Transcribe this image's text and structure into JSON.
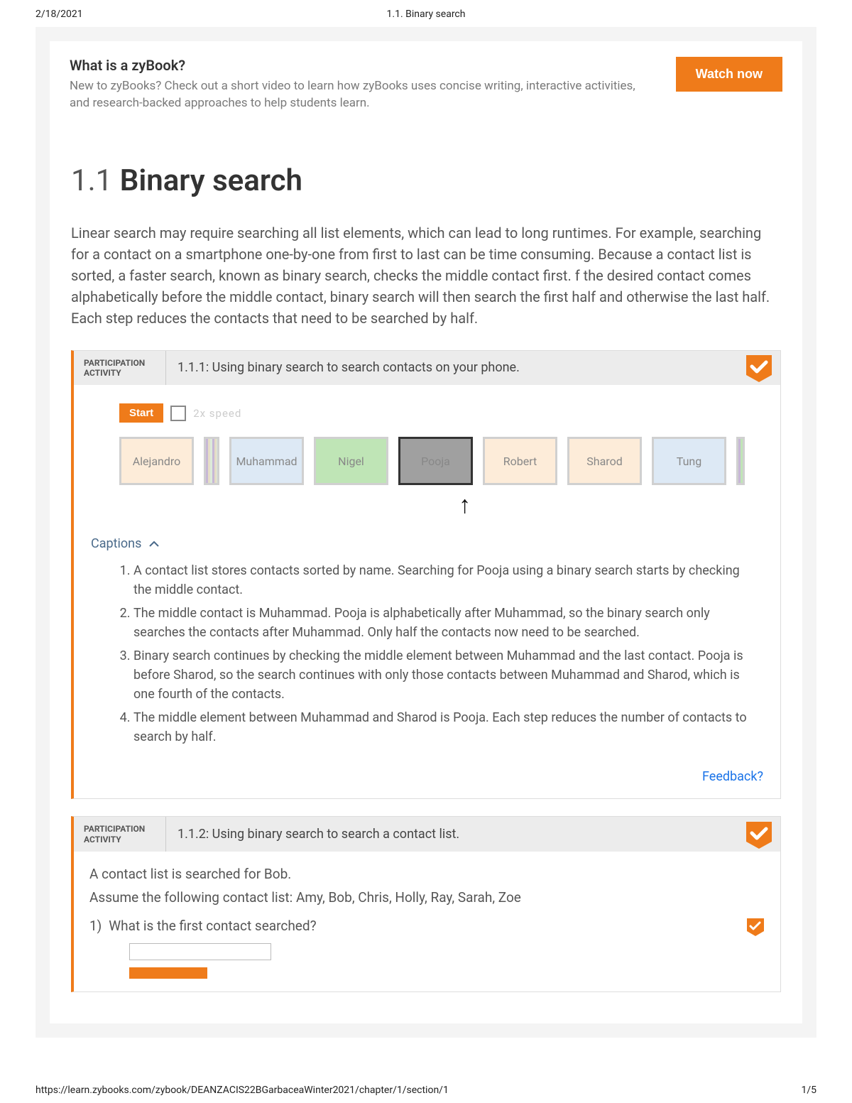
{
  "print": {
    "date": "2/18/2021",
    "title": "1.1. Binary search",
    "url": "https://learn.zybooks.com/zybook/DEANZACIS22BGarbaceaWinter2021/chapter/1/section/1",
    "page": "1/5"
  },
  "promo": {
    "heading": "What is a zyBook?",
    "text": "New to zyBooks? Check out a short video to learn how zyBooks uses concise writing, interactive activities, and research-backed approaches to help students learn.",
    "button": "Watch now"
  },
  "section": {
    "number": "1.1",
    "title": "Binary search",
    "intro": "Linear search may require searching all list elements, which can lead to long runtimes. For example, searching for a contact on a smartphone one-by-one from first to last can be time consuming. Because a contact list is sorted, a faster search, known as binary search, checks the middle contact first. f the desired contact comes alphabetically before the middle contact, binary search will then search the first half and otherwise the last half. Each step reduces the contacts that need to be searched by half."
  },
  "activity1": {
    "label_line1": "PARTICIPATION",
    "label_line2": "ACTIVITY",
    "title": "1.1.1: Using binary search to search contacts on your phone.",
    "start": "Start",
    "speed": "2x speed",
    "contacts": [
      "Alejandro",
      "Muhammad",
      "Nigel",
      "Pooja",
      "Robert",
      "Sharod",
      "Tung"
    ],
    "captions_label": "Captions",
    "captions": [
      "A contact list stores contacts sorted by name. Searching for Pooja using a binary search starts by checking the middle contact.",
      "The middle contact is Muhammad. Pooja is alphabetically after Muhammad, so the binary search only searches the contacts after Muhammad. Only half the contacts now need to be searched.",
      "Binary search continues by checking the middle element between Muhammad and the last contact. Pooja is before Sharod, so the search continues with only those contacts between Muhammad and Sharod, which is one fourth of the contacts.",
      "The middle element between Muhammad and Sharod is Pooja. Each step reduces the number of contacts to search by half."
    ],
    "feedback": "Feedback?"
  },
  "activity2": {
    "label_line1": "PARTICIPATION",
    "label_line2": "ACTIVITY",
    "title": "1.1.2: Using binary search to search a contact list.",
    "prompt1": "A contact list is searched for Bob.",
    "prompt2": "Assume the following contact list: Amy, Bob, Chris, Holly, Ray, Sarah, Zoe",
    "q1_num": "1)",
    "q1_text": "What is the first contact searched?"
  }
}
